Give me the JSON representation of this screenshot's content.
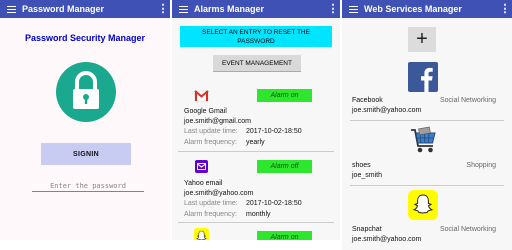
{
  "screen1": {
    "appbar_title": "Password Manager",
    "heading": "Password Security Manager",
    "signin_label": "SIGNIN",
    "password_placeholder": "Enter the password",
    "colors": {
      "appbar": "#3f51b5",
      "heading": "#0000cc",
      "lock_circle": "#1aa98f",
      "signin_bg": "#c8cbf2",
      "underline": "#d05b8f"
    },
    "icons": [
      "menu-icon",
      "more-vert-icon",
      "lock-icon"
    ]
  },
  "screen2": {
    "appbar_title": "Alarms Manager",
    "reset_line1": "SELECT AN ENTRY TO RESET THE",
    "reset_line2": "PASSWORD",
    "event_label": "EVENT MANAGEMENT",
    "labels": {
      "last_update": "Last update time:",
      "frequency": "Alarm frequency:"
    },
    "alarms": [
      {
        "name": "Google Gmail",
        "email": "joe.smith@gmail.com",
        "last_update": "2017-10-02-18:50",
        "frequency": "yearly",
        "button": "Alarm on",
        "icon": "gmail-icon"
      },
      {
        "name": "Yahoo email",
        "email": "joe.smith@yahoo.com",
        "last_update": "2017-10-02-18:50",
        "frequency": "monthly",
        "button": "Alarm off",
        "icon": "yahoo-icon"
      },
      {
        "button": "Alarm on",
        "icon": "snapchat-icon"
      }
    ],
    "colors": {
      "reset_bg": "#00e5ff",
      "alarm_button": "#2ee62e"
    }
  },
  "screen3": {
    "appbar_title": "Web Services Manager",
    "add_label": "+",
    "services": [
      {
        "name": "Facebook",
        "category": "Social Networking",
        "email": "joe.smith@yahoo.com",
        "icon": "facebook-icon"
      },
      {
        "name": "shoes",
        "category": "Shopping",
        "email": "joe_smith",
        "icon": "shopping-cart-icon"
      },
      {
        "name": "Snapchat",
        "category": "Social Networking",
        "email": "joe.smith@yahoo.com",
        "icon": "snapchat-icon"
      }
    ]
  }
}
